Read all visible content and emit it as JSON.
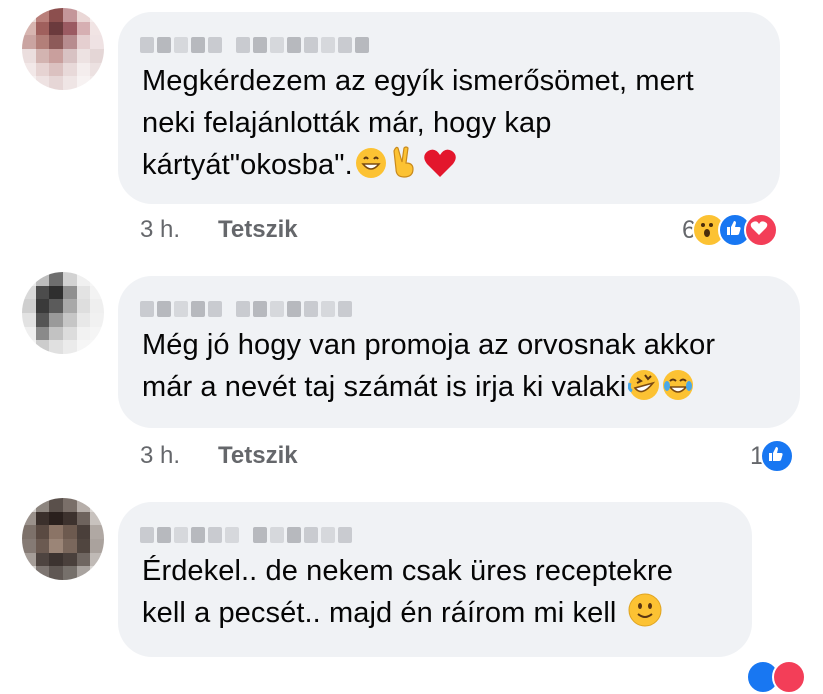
{
  "comments": [
    {
      "text_lines": [
        "Megkérdezem az egyík ismerősömet, mert",
        "neki felajánlották már, hogy kap",
        "kártyát\"okosba\"."
      ],
      "time": "3 h.",
      "like_label": "Tetszik",
      "reaction_count": "6",
      "reaction_icons": [
        "wow-icon",
        "like-icon",
        "love-icon"
      ]
    },
    {
      "text_lines": [
        "Még jó hogy van promoja az orvosnak akkor",
        "már a nevét taj számát is irja ki valaki"
      ],
      "time": "3 h.",
      "like_label": "Tetszik",
      "reaction_count": "1",
      "reaction_icons": [
        "like-icon"
      ]
    },
    {
      "text_lines": [
        "Érdekel.. de nekem csak üres receptekre",
        "kell a pecsét.. majd én ráírom mi kell"
      ],
      "time": "",
      "like_label": "",
      "reaction_count": "",
      "reaction_icons": []
    }
  ],
  "colors": {
    "bubble": "#f0f2f5",
    "meta_text": "#65676b",
    "like_blue": "#1877f2",
    "love_red": "#f33e58",
    "emoji_yellow": "#fcc233"
  }
}
